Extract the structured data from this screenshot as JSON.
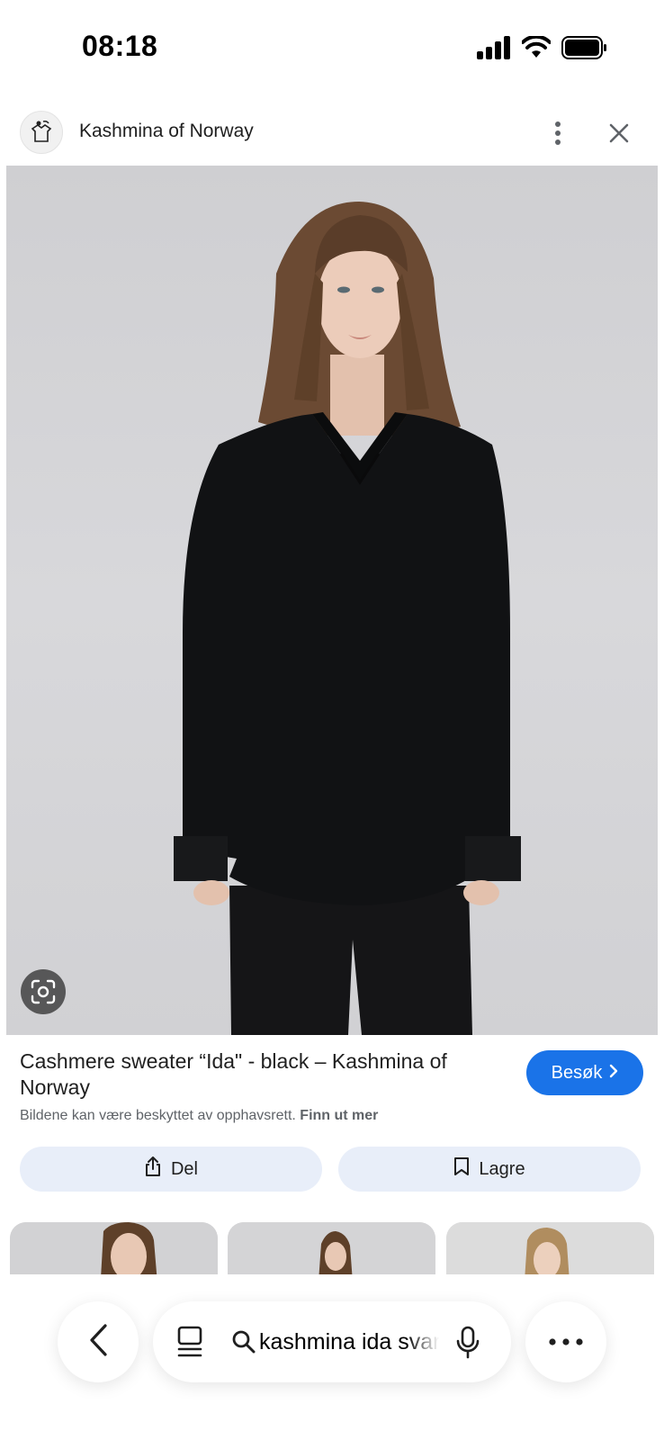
{
  "status_bar": {
    "time": "08:18",
    "icons": [
      "cellular-signal-icon",
      "wifi-icon",
      "battery-icon"
    ]
  },
  "header": {
    "site_name": "Kashmina of Norway",
    "icons": [
      "site-logo-icon",
      "more-vert-icon",
      "close-icon"
    ]
  },
  "product": {
    "title": "Cashmere sweater “Ida\" - black – Kashmina of Norway",
    "visit_label": "Besøk",
    "copyright_text": "Bildene kan være beskyttet av opphavsrett.",
    "learn_more": "Finn ut mer"
  },
  "actions": {
    "share_label": "Del",
    "save_label": "Lagre"
  },
  "related": {
    "count": 3
  },
  "bottom_bar": {
    "search_value": "kashmina ida svart",
    "icons": [
      "back-chevron-icon",
      "tabs-icon",
      "search-icon",
      "mic-icon",
      "more-horiz-icon"
    ]
  },
  "colors": {
    "accent": "#1a73e8",
    "chip_bg": "#e8eef9",
    "sweater": "#111214",
    "photo_bg": "#d3d3d6"
  }
}
